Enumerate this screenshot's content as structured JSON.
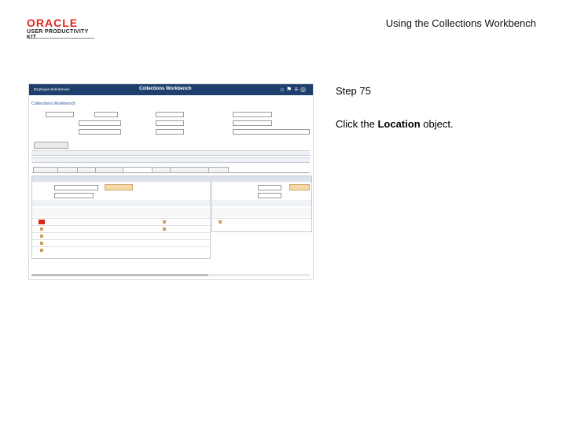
{
  "doc": {
    "logo_brand": "ORACLE",
    "logo_sub": "USER PRODUCTIVITY KIT",
    "title": "Using the Collections Workbench",
    "step": "Step 75",
    "instruction_pre": "Click the ",
    "instruction_object": "Location",
    "instruction_post": " object."
  },
  "app": {
    "nav_label": "Employee Self-Service",
    "window_title": "Collections Workbench",
    "page_title": "Collections Workbench",
    "colors": {
      "banner": "#1f3f6e",
      "link": "#2a5a9a",
      "accent_red": "#d42a1a"
    }
  }
}
